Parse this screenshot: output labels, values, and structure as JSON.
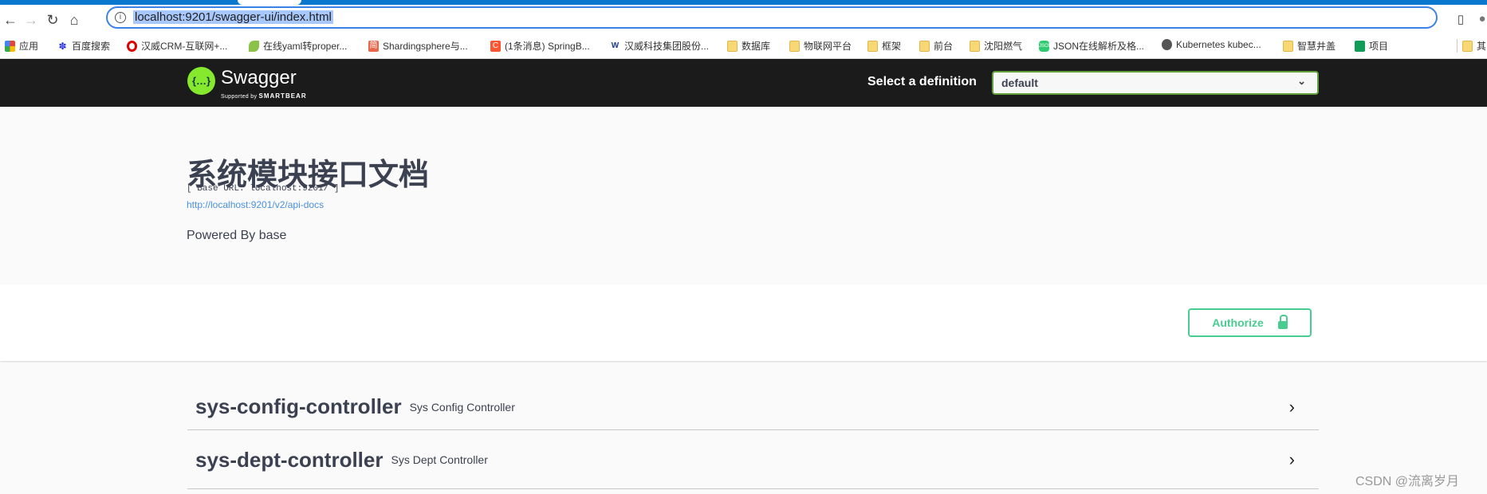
{
  "browser": {
    "url": "localhost:9201/swagger-ui/index.html",
    "bookmarks": [
      {
        "label": "应用",
        "icon": "apps-grid-icon"
      },
      {
        "label": "百度搜索",
        "icon": "baidu-paw-icon"
      },
      {
        "label": "汉威CRM-互联网+...",
        "icon": "red-circle-icon"
      },
      {
        "label": "在线yaml转proper...",
        "icon": "spring-leaf-icon"
      },
      {
        "label": "Shardingsphere与...",
        "icon": "jian-icon"
      },
      {
        "label": "(1条消息) SpringB...",
        "icon": "csdn-c-icon"
      },
      {
        "label": "汉威科技集团股份...",
        "icon": "hanwei-logo-icon"
      },
      {
        "label": "数据库",
        "icon": "folder-icon"
      },
      {
        "label": "物联网平台",
        "icon": "folder-icon"
      },
      {
        "label": "框架",
        "icon": "folder-icon"
      },
      {
        "label": "前台",
        "icon": "folder-icon"
      },
      {
        "label": "沈阳燃气",
        "icon": "folder-icon"
      },
      {
        "label": "JSON在线解析及格...",
        "icon": "json-icon"
      },
      {
        "label": "Kubernetes kubec...",
        "icon": "globe-icon"
      },
      {
        "label": "智慧井盖",
        "icon": "folder-icon"
      },
      {
        "label": "项目",
        "icon": "sheets-icon"
      },
      {
        "label": "其",
        "icon": "folder-icon"
      }
    ]
  },
  "header": {
    "brand": "Swagger",
    "supported_by": "Supported by",
    "smartbear": "SMARTBEAR",
    "logo_text": "{…}",
    "select_label": "Select a definition",
    "selected_definition": "default"
  },
  "info": {
    "title": "系统模块接口文档",
    "base_url": "[ Base URL: localhost:9201/ ]",
    "docs_link": "http://localhost:9201/v2/api-docs",
    "description": "Powered By base"
  },
  "authorize_label": "Authorize",
  "tags": [
    {
      "name": "sys-config-controller",
      "description": "Sys Config Controller"
    },
    {
      "name": "sys-dept-controller",
      "description": "Sys Dept Controller"
    }
  ],
  "watermark": "CSDN @流离岁月",
  "colors": {
    "accent": "#49cc90",
    "topbar": "#1b1b1b",
    "select_border": "#62a03f",
    "link": "#4990e2"
  }
}
